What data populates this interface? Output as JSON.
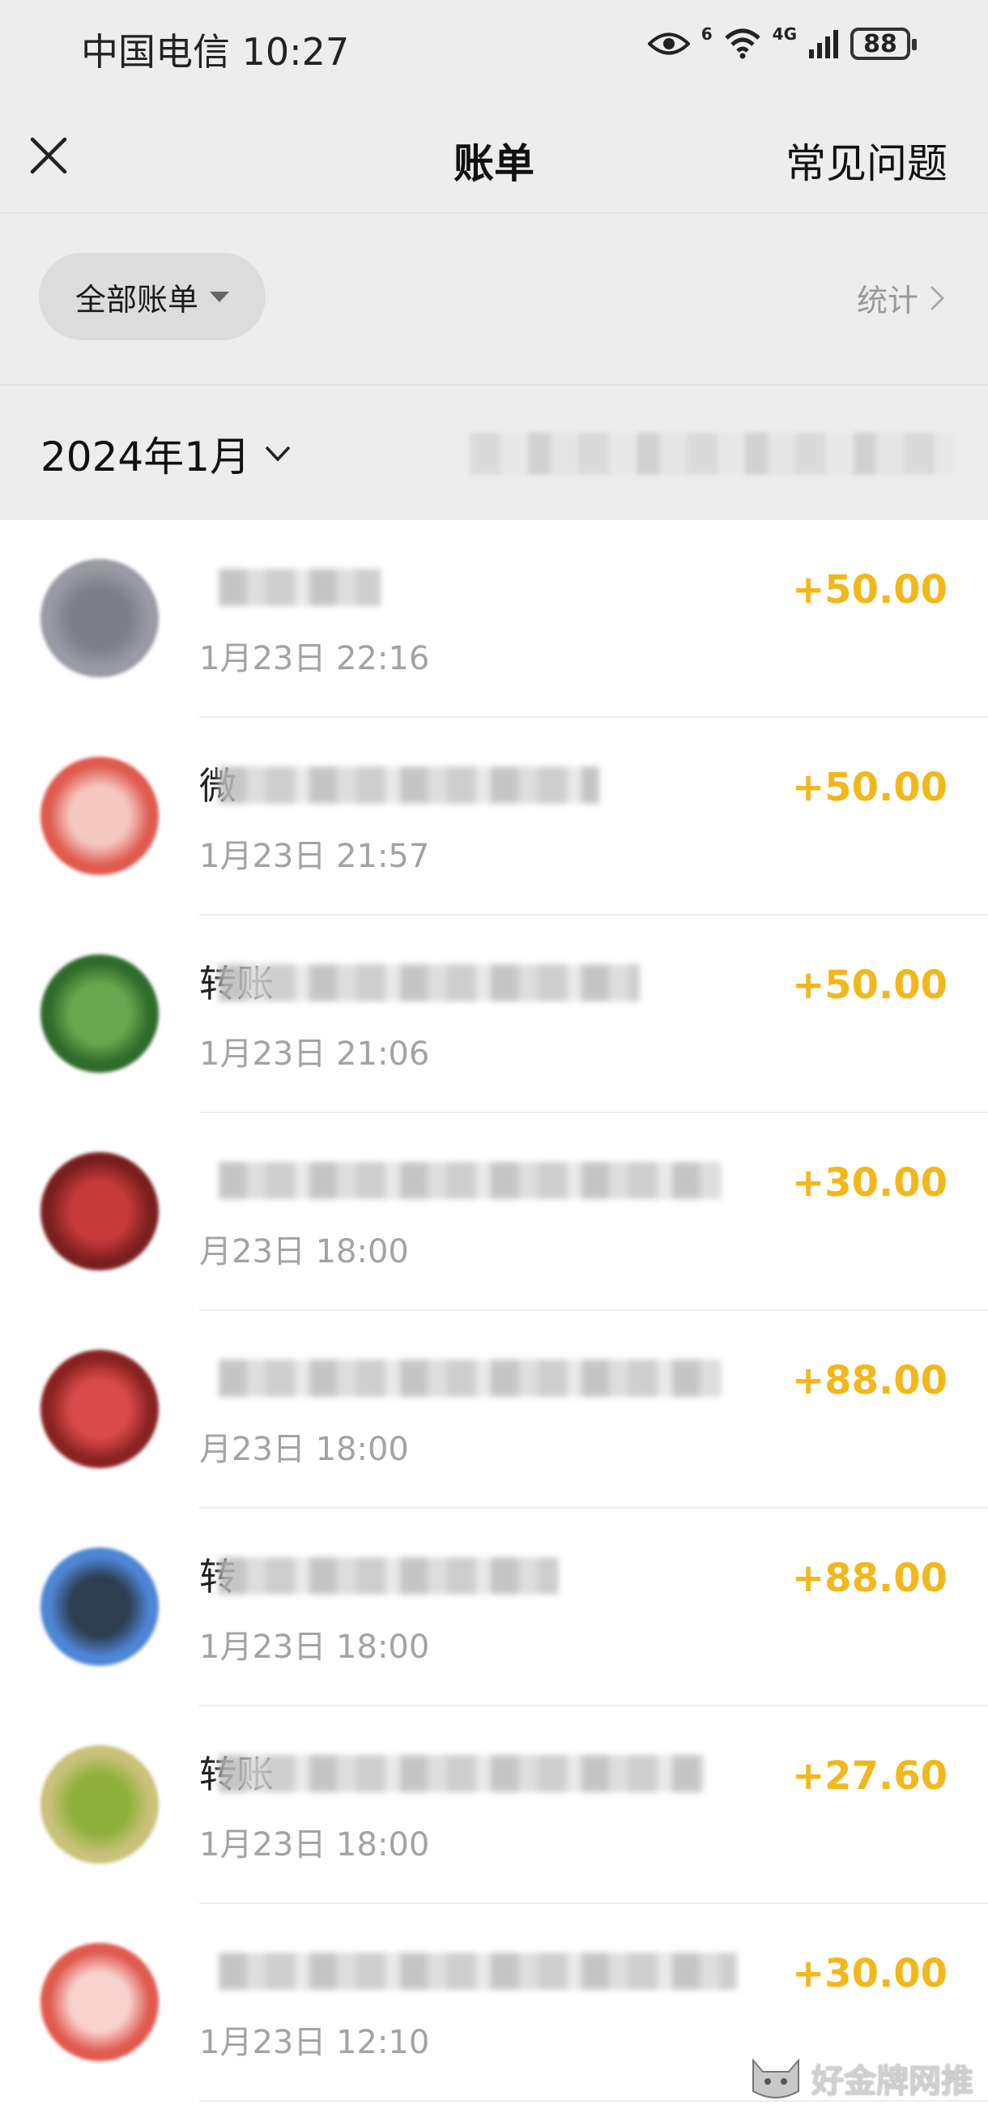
{
  "status_bar": {
    "carrier_time": "中国电信 10:27",
    "wifi_label": "6",
    "network_label": "4G",
    "battery": "88"
  },
  "nav": {
    "title": "账单",
    "faq_label": "常见问题"
  },
  "filter": {
    "chip_label": "全部账单",
    "stats_label": "统计"
  },
  "month": {
    "label": "2024年1月"
  },
  "bills": [
    {
      "title_char": "",
      "time": "1月23日 22:16",
      "amount": "+50.00",
      "avatar_colors": [
        "#9a9aa6",
        "#7e7e88"
      ],
      "blur_width": 200
    },
    {
      "title_char": "微",
      "time": "1月23日 21:57",
      "amount": "+50.00",
      "avatar_colors": [
        "#e05a4e",
        "#f5c8c0"
      ],
      "blur_width": 470
    },
    {
      "title_char": "转账",
      "time": "1月23日 21:06",
      "amount": "+50.00",
      "avatar_colors": [
        "#2f6b2a",
        "#6aa84f"
      ],
      "blur_width": 520
    },
    {
      "title_char": "",
      "time": "月23日 18:00",
      "amount": "+30.00",
      "avatar_colors": [
        "#7a1f1f",
        "#c63a3a"
      ],
      "blur_width": 620
    },
    {
      "title_char": "",
      "time": "月23日 18:00",
      "amount": "+88.00",
      "avatar_colors": [
        "#8a2222",
        "#d94a4a"
      ],
      "blur_width": 620
    },
    {
      "title_char": "转",
      "time": "1月23日 18:00",
      "amount": "+88.00",
      "avatar_colors": [
        "#4e86d6",
        "#2c3e50"
      ],
      "blur_width": 420
    },
    {
      "title_char": "转账",
      "time": "1月23日 18:00",
      "amount": "+27.60",
      "avatar_colors": [
        "#c9c27a",
        "#8fb03a"
      ],
      "blur_width": 600
    },
    {
      "title_char": "",
      "time": "1月23日 12:10",
      "amount": "+30.00",
      "avatar_colors": [
        "#e05a4e",
        "#f7d2cc"
      ],
      "blur_width": 640
    }
  ],
  "watermark": {
    "text": "好金牌网推",
    "icon": "cat-icon"
  }
}
